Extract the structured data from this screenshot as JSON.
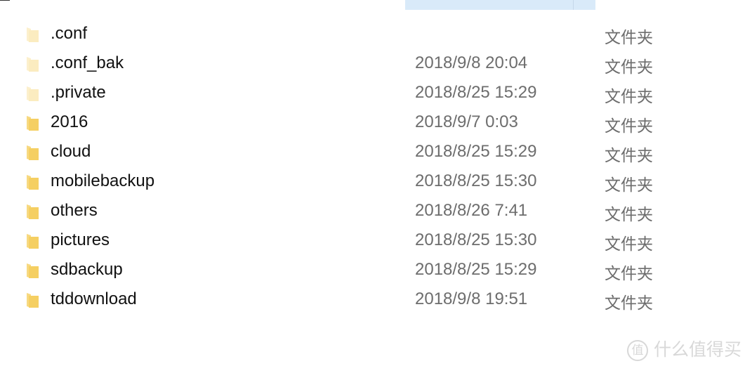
{
  "colors": {
    "header": "#d9eaf9",
    "folder": "#f5cf62",
    "hidden_folder": "#fbecc0"
  },
  "files": [
    {
      "name": ".conf",
      "date": "",
      "type": "文件夹",
      "hidden": true
    },
    {
      "name": ".conf_bak",
      "date": "2018/9/8 20:04",
      "type": "文件夹",
      "hidden": true
    },
    {
      "name": ".private",
      "date": "2018/8/25 15:29",
      "type": "文件夹",
      "hidden": true
    },
    {
      "name": "2016",
      "date": "2018/9/7 0:03",
      "type": "文件夹",
      "hidden": false
    },
    {
      "name": "cloud",
      "date": "2018/8/25 15:29",
      "type": "文件夹",
      "hidden": false
    },
    {
      "name": "mobilebackup",
      "date": "2018/8/25 15:30",
      "type": "文件夹",
      "hidden": false
    },
    {
      "name": "others",
      "date": "2018/8/26 7:41",
      "type": "文件夹",
      "hidden": false
    },
    {
      "name": "pictures",
      "date": "2018/8/25 15:30",
      "type": "文件夹",
      "hidden": false
    },
    {
      "name": "sdbackup",
      "date": "2018/8/25 15:29",
      "type": "文件夹",
      "hidden": false
    },
    {
      "name": "tddownload",
      "date": "2018/9/8 19:51",
      "type": "文件夹",
      "hidden": false
    }
  ],
  "watermark": {
    "badge": "值",
    "text": "什么值得买"
  }
}
